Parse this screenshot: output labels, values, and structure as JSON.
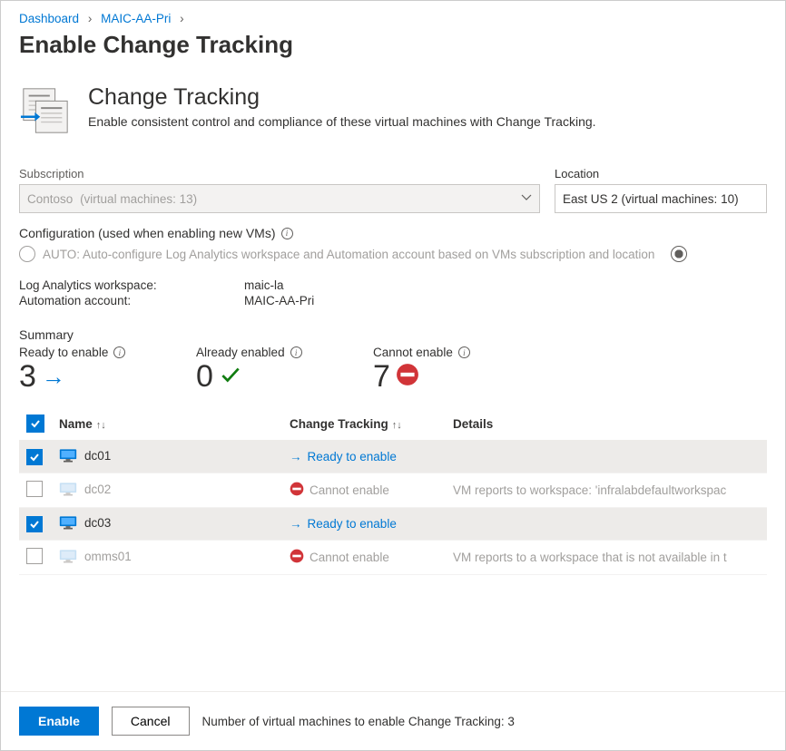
{
  "breadcrumb": {
    "items": [
      "Dashboard",
      "MAIC-AA-Pri"
    ]
  },
  "page_title": "Enable Change Tracking",
  "hero": {
    "title": "Change Tracking",
    "desc": "Enable consistent control and compliance of these virtual machines with Change Tracking."
  },
  "subscription": {
    "label": "Subscription",
    "name": "Contoso",
    "suffix": "(virtual machines: 13)"
  },
  "location": {
    "label": "Location",
    "value": "East US 2 (virtual machines: 10)"
  },
  "config": {
    "title": "Configuration (used when enabling new VMs)",
    "auto_label": "AUTO: Auto-configure Log Analytics workspace and Automation account based on VMs subscription and location"
  },
  "kv": {
    "law_label": "Log Analytics workspace:",
    "law_value": "maic-la",
    "aa_label": "Automation account:",
    "aa_value": "MAIC-AA-Pri"
  },
  "summary": {
    "title": "Summary",
    "ready": {
      "label": "Ready to enable",
      "value": "3"
    },
    "already": {
      "label": "Already enabled",
      "value": "0"
    },
    "cannot": {
      "label": "Cannot enable",
      "value": "7"
    }
  },
  "table": {
    "headers": {
      "name": "Name",
      "ct": "Change Tracking",
      "details": "Details"
    },
    "rows": [
      {
        "checked": true,
        "name": "dc01",
        "status": "ready",
        "status_text": "Ready to enable",
        "details": ""
      },
      {
        "checked": false,
        "name": "dc02",
        "status": "cannot",
        "status_text": "Cannot enable",
        "details": "VM reports to workspace: 'infralabdefaultworkspac"
      },
      {
        "checked": true,
        "name": "dc03",
        "status": "ready",
        "status_text": "Ready to enable",
        "details": ""
      },
      {
        "checked": false,
        "name": "omms01",
        "status": "cannot",
        "status_text": "Cannot enable",
        "details": "VM reports to a workspace that is not available in t"
      }
    ]
  },
  "footer": {
    "enable": "Enable",
    "cancel": "Cancel",
    "count_text": "Number of virtual machines to enable Change Tracking: 3"
  }
}
